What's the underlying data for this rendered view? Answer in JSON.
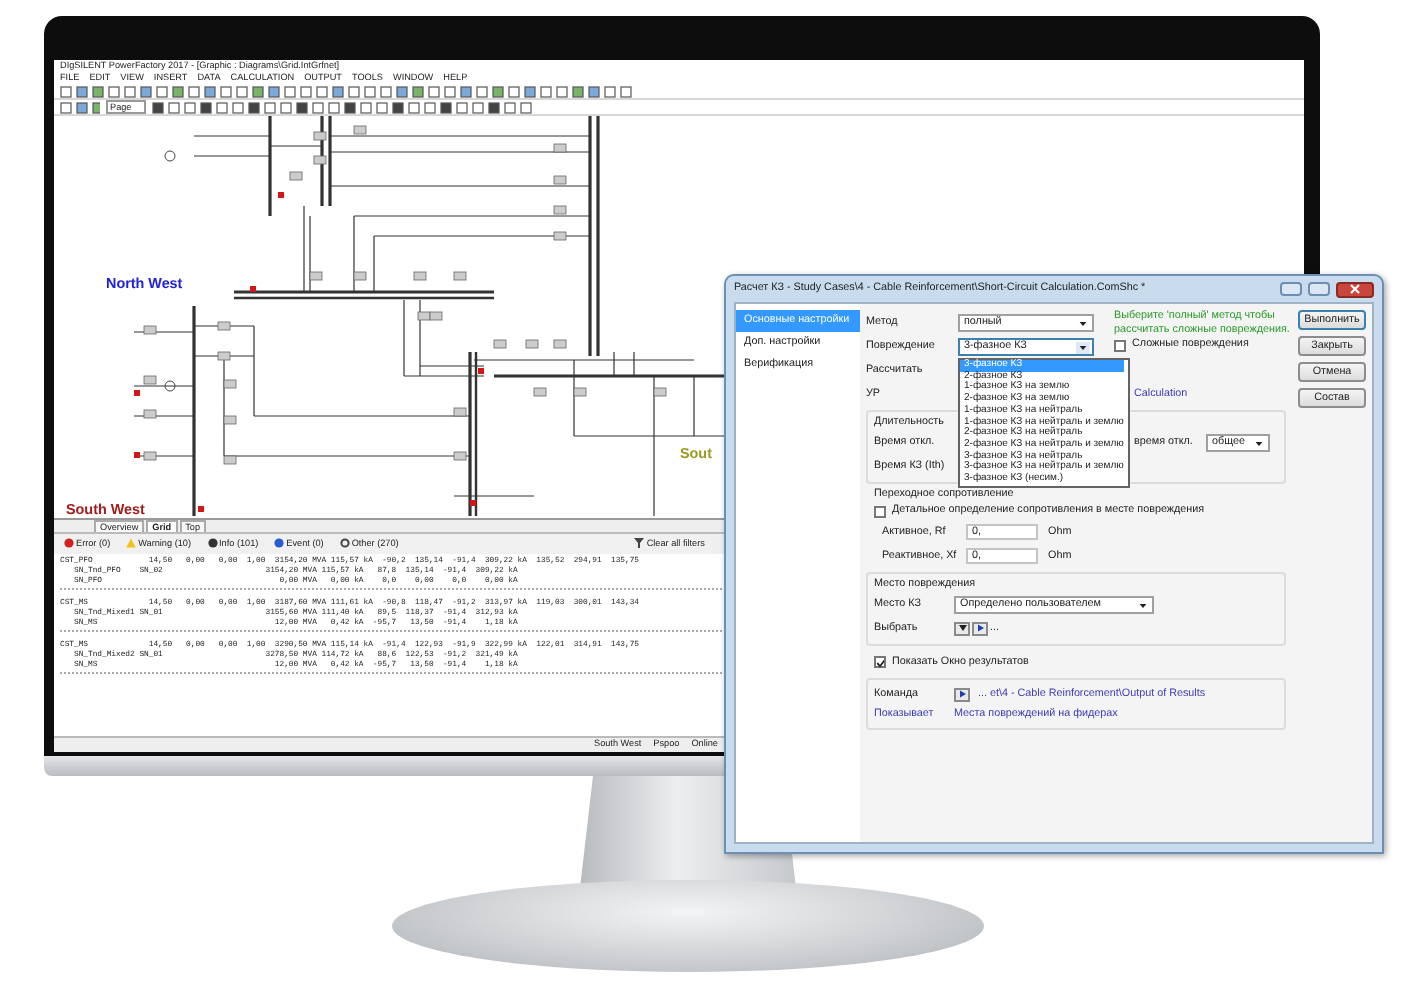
{
  "app": {
    "title": "DIgSILENT PowerFactory 2017 - [Graphic : Diagrams\\Grid.IntGrfnet]",
    "menu": [
      "FILE",
      "EDIT",
      "VIEW",
      "INSERT",
      "DATA",
      "CALCULATION",
      "OUTPUT",
      "TOOLS",
      "WINDOW",
      "HELP"
    ],
    "zoom_combo": "Page",
    "diagram": {
      "regions": [
        {
          "label": "North West",
          "color": "#1f22d8"
        },
        {
          "label": "South West",
          "color": "#a51c1c"
        },
        {
          "label": "Sout",
          "color": "#9c9a22"
        }
      ]
    },
    "view_tabs": [
      {
        "label": "Overview",
        "selected": false
      },
      {
        "label": "Grid",
        "selected": true
      },
      {
        "label": "Top",
        "selected": false
      }
    ],
    "output": {
      "filters": [
        {
          "label": "Error (0)",
          "kind": "error"
        },
        {
          "label": "Warning (10)",
          "kind": "warning"
        },
        {
          "label": "Info (101)",
          "kind": "info"
        },
        {
          "label": "Event (0)",
          "kind": "event"
        },
        {
          "label": "Other (270)",
          "kind": "other"
        }
      ],
      "clear_button": "Clear all filters",
      "groups": [
        [
          "CST_PFO            14,50   0,00   0,00  1,00  3154,20 MVA 115,57 kA  -90,2  135,14  -91,4  309,22 kA  135,52  294,91  135,75",
          "   SN_Tnd_PFO    SN_02                      3154,20 MVA 115,57 kA   87,8  135,14  -91,4  309,22 kA",
          "   SN_PFO                                      0,00 MVA   0,00 kA    0,0    0,00    0,0    0,00 kA"
        ],
        [
          "CST_MS             14,50   0,00   0,00  1,00  3187,60 MVA 111,61 kA  -90,8  118,47  -91,2  313,97 kA  119,03  300,01  143,34",
          "   SN_Tnd_Mixed1 SN_01                      3155,60 MVA 111,40 kA   89,5  118,37  -91,4  312,93 kA",
          "   SN_MS                                      12,00 MVA   0,42 kA  -95,7   13,50  -91,4    1,18 kA"
        ],
        [
          "CST_MS             14,50   0,00   0,00  1,00  3290,50 MVA 115,14 kA  -91,4  122,93  -91,9  322,99 kA  122,01  314,91  143,75",
          "   SN_Tnd_Mixed2 SN_01                      3278,50 MVA 114,72 kA   88,6  122,53  -91,2  321,49 kA",
          "   SN_MS                                      12,00 MVA   0,42 kA  -95,7   13,50  -91,4    1,18 kA"
        ]
      ]
    },
    "status_bar": [
      "South West",
      "Pspoo",
      "Online"
    ]
  },
  "dialog": {
    "title": "Расчет КЗ - Study Cases\\4 - Cable Reinforcement\\Short-Circuit Calculation.ComShc *",
    "nav": [
      {
        "label": "Основные настройки",
        "selected": true
      },
      {
        "label": "Доп. настройки",
        "selected": false
      },
      {
        "label": "Верификация",
        "selected": false
      }
    ],
    "method": {
      "label": "Метод",
      "value": "полный"
    },
    "fault": {
      "label": "Повреждение",
      "value": "3-фазное КЗ",
      "expanded": true,
      "options": [
        {
          "label": "3-фазное КЗ",
          "selected": true
        },
        {
          "label": "2-фазное КЗ",
          "selected": false
        },
        {
          "label": "1-фазное КЗ на землю",
          "selected": false
        },
        {
          "label": "2-фазное КЗ на землю",
          "selected": false
        },
        {
          "label": "1-фазное КЗ на нейтраль",
          "selected": false
        },
        {
          "label": "1-фазное КЗ на нейтраль и землю",
          "selected": false
        },
        {
          "label": "2-фазное КЗ на нейтраль",
          "selected": false
        },
        {
          "label": "2-фазное КЗ на нейтраль и землю",
          "selected": false
        },
        {
          "label": "3-фазное КЗ на нейтраль",
          "selected": false
        },
        {
          "label": "3-фазное КЗ на нейтраль и землю",
          "selected": false
        },
        {
          "label": "3-фазное КЗ (несим.)",
          "selected": false
        }
      ]
    },
    "hint": "Выберите 'полный' метод чтобы рассчитать сложные повреждения.",
    "complex_faults": {
      "label": "Сложные повреждения",
      "checked": false
    },
    "calculate_label": "Рассчитать",
    "ur_label": "УР",
    "calculation_link": "Calculation",
    "duration": {
      "title": "Длительность",
      "break_time_label": "Время откл.",
      "fault_time_label": "Время КЗ (Ith)",
      "break_time_suffix": "время откл.",
      "break_time_mode": "общее"
    },
    "resistance": {
      "title": "Переходное сопротивление",
      "detailed": {
        "label": "Детальное определение сопротивления в месте повреждения",
        "checked": false
      },
      "rows": [
        {
          "label": "Активное, Rf",
          "value": "0,",
          "unit": "Ohm"
        },
        {
          "label": "Реактивное, Xf",
          "value": "0,",
          "unit": "Ohm"
        }
      ]
    },
    "location": {
      "title": "Место повреждения",
      "place_label": "Место КЗ",
      "place_value": "Определено пользователем",
      "select_label": "Выбрать",
      "select_ellipsis": "..."
    },
    "results": {
      "show": {
        "label": "Показать Окно результатов",
        "checked": true
      },
      "command_label": "Команда",
      "command_link": "... et\\4 - Cable Reinforcement\\Output of Results",
      "shows_label": "Показывает",
      "shows_value": "Места повреждений на фидерах"
    },
    "buttons": [
      "Выполнить",
      "Закрыть",
      "Отмена",
      "Состав"
    ]
  }
}
